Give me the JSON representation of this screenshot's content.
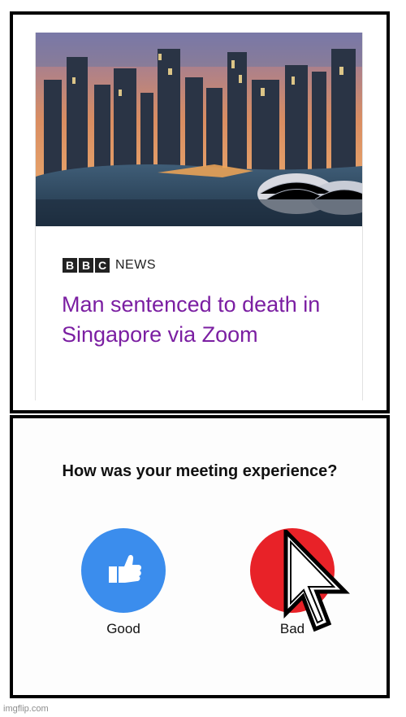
{
  "top_panel": {
    "brand_letters": [
      "B",
      "B",
      "C"
    ],
    "brand_word": "NEWS",
    "headline": "Man sentenced to death in Singapore via Zoom",
    "headline_color": "#7b1fa2",
    "image_icon": "city-skyline-image"
  },
  "bottom_panel": {
    "question": "How was your meeting experience?",
    "good_label": "Good",
    "bad_label": "Bad",
    "good_color": "#3b8ded",
    "bad_color": "#e82228",
    "good_icon": "thumbs-up-icon",
    "cursor_icon": "mouse-pointer-icon"
  },
  "watermark": "imgflip.com"
}
